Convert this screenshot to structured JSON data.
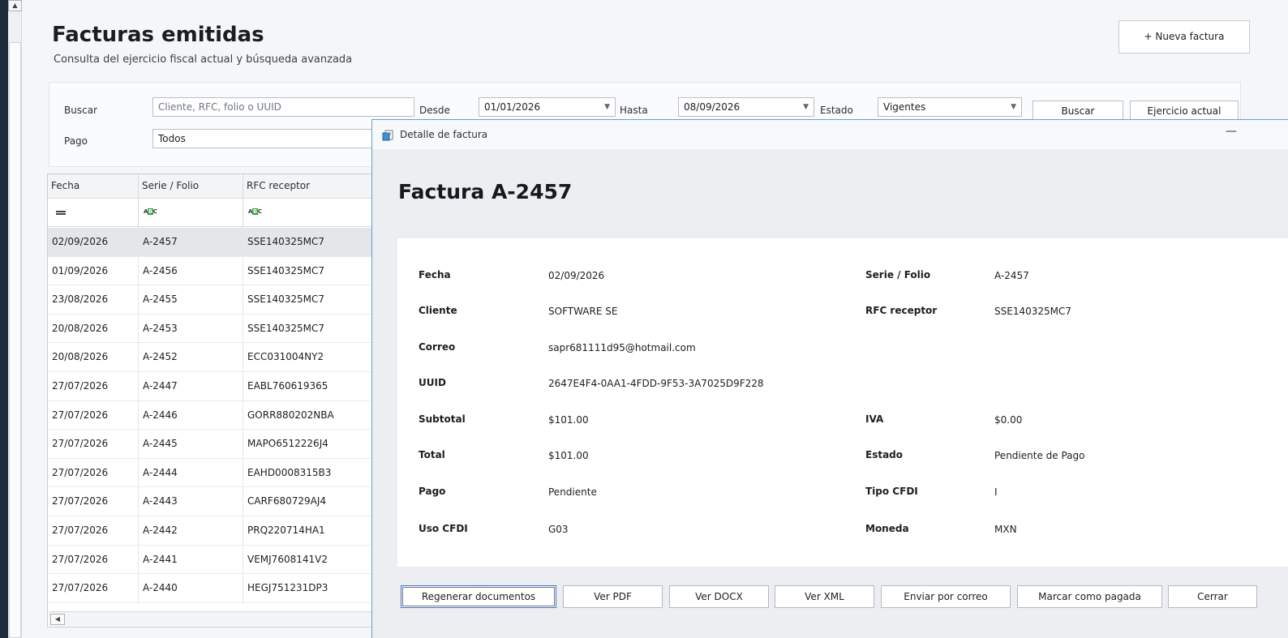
{
  "header": {
    "title": "Facturas emitidas",
    "subtitle": "Consulta del ejercicio fiscal actual y búsqueda avanzada",
    "new_invoice": "+ Nueva factura"
  },
  "filters": {
    "search_label": "Buscar",
    "search_placeholder": "Cliente, RFC, folio o UUID",
    "from_label": "Desde",
    "from_value": "01/01/2026",
    "to_label": "Hasta",
    "to_value": "08/09/2026",
    "status_label": "Estado",
    "status_value": "Vigentes",
    "search_button": "Buscar",
    "fiscal_year_button": "Ejercicio actual",
    "payment_label": "Pago",
    "payment_value": "Todos"
  },
  "grid": {
    "columns": [
      "Fecha",
      "Serie / Folio",
      "RFC receptor"
    ],
    "rows": [
      {
        "fecha": "02/09/2026",
        "folio": "A-2457",
        "rfc": "SSE140325MC7"
      },
      {
        "fecha": "01/09/2026",
        "folio": "A-2456",
        "rfc": "SSE140325MC7"
      },
      {
        "fecha": "23/08/2026",
        "folio": "A-2455",
        "rfc": "SSE140325MC7"
      },
      {
        "fecha": "20/08/2026",
        "folio": "A-2453",
        "rfc": "SSE140325MC7"
      },
      {
        "fecha": "20/08/2026",
        "folio": "A-2452",
        "rfc": "ECC031004NY2"
      },
      {
        "fecha": "27/07/2026",
        "folio": "A-2447",
        "rfc": "EABL760619365"
      },
      {
        "fecha": "27/07/2026",
        "folio": "A-2446",
        "rfc": "GORR880202NBA"
      },
      {
        "fecha": "27/07/2026",
        "folio": "A-2445",
        "rfc": "MAPO6512226J4"
      },
      {
        "fecha": "27/07/2026",
        "folio": "A-2444",
        "rfc": "EAHD0008315B3"
      },
      {
        "fecha": "27/07/2026",
        "folio": "A-2443",
        "rfc": "CARF680729AJ4"
      },
      {
        "fecha": "27/07/2026",
        "folio": "A-2442",
        "rfc": "PRQ220714HA1"
      },
      {
        "fecha": "27/07/2026",
        "folio": "A-2441",
        "rfc": "VEMJ7608141V2"
      },
      {
        "fecha": "27/07/2026",
        "folio": "A-2440",
        "rfc": "HEGJ751231DP3"
      }
    ]
  },
  "dialog": {
    "title": "Detalle de factura",
    "minimize": "—",
    "heading": "Factura A-2457",
    "fields": {
      "fecha_label": "Fecha",
      "fecha": "02/09/2026",
      "serie_label": "Serie / Folio",
      "serie": "A-2457",
      "cliente_label": "Cliente",
      "cliente": "SOFTWARE SE",
      "rfc_label": "RFC receptor",
      "rfc": "SSE140325MC7",
      "correo_label": "Correo",
      "correo": "sapr681111d95@hotmail.com",
      "uuid_label": "UUID",
      "uuid": "2647E4F4-0AA1-4FDD-9F53-3A7025D9F228",
      "subtotal_label": "Subtotal",
      "subtotal": "$101.00",
      "iva_label": "IVA",
      "iva": "$0.00",
      "total_label": "Total",
      "total": "$101.00",
      "estado_label": "Estado",
      "estado": "Pendiente de Pago",
      "pago_label": "Pago",
      "pago": "Pendiente",
      "tipo_label": "Tipo CFDI",
      "tipo": "I",
      "uso_label": "Uso CFDI",
      "uso": "G03",
      "moneda_label": "Moneda",
      "moneda": "MXN"
    },
    "actions": {
      "regenerate": "Regenerar documentos",
      "pdf": "Ver PDF",
      "docx": "Ver DOCX",
      "xml": "Ver XML",
      "email": "Enviar por correo",
      "mark_paid": "Marcar como pagada",
      "close": "Cerrar"
    }
  }
}
